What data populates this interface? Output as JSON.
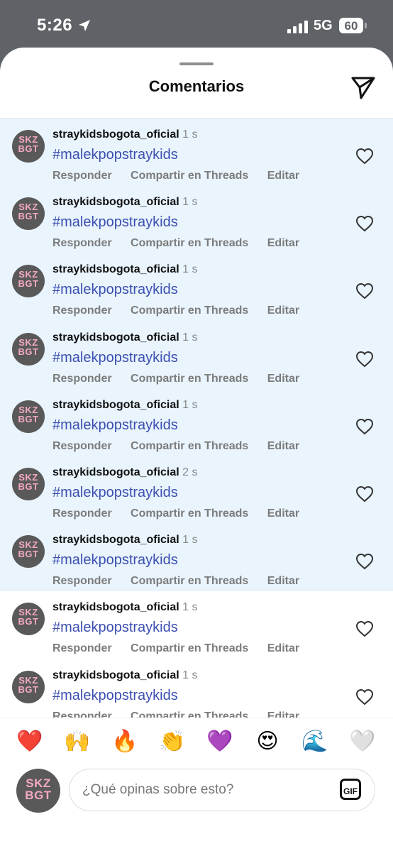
{
  "status_bar": {
    "time": "5:26",
    "network": "5G",
    "battery": "60"
  },
  "header": {
    "title": "Comentarios"
  },
  "avatar_text": [
    "SKZ",
    "BGT"
  ],
  "comments": [
    {
      "user": "straykidsbogota_oficial",
      "time": "1 s",
      "text": "#malekpopstraykids",
      "highlighted": true
    },
    {
      "user": "straykidsbogota_oficial",
      "time": "1 s",
      "text": "#malekpopstraykids",
      "highlighted": true
    },
    {
      "user": "straykidsbogota_oficial",
      "time": "1 s",
      "text": "#malekpopstraykids",
      "highlighted": true
    },
    {
      "user": "straykidsbogota_oficial",
      "time": "1 s",
      "text": "#malekpopstraykids",
      "highlighted": true
    },
    {
      "user": "straykidsbogota_oficial",
      "time": "1 s",
      "text": "#malekpopstraykids",
      "highlighted": true
    },
    {
      "user": "straykidsbogota_oficial",
      "time": "2 s",
      "text": "#malekpopstraykids",
      "highlighted": true
    },
    {
      "user": "straykidsbogota_oficial",
      "time": "1 s",
      "text": "#malekpopstraykids",
      "highlighted": true
    },
    {
      "user": "straykidsbogota_oficial",
      "time": "1 s",
      "text": "#malekpopstraykids",
      "highlighted": false
    },
    {
      "user": "straykidsbogota_oficial",
      "time": "1 s",
      "text": "#malekpopstraykids",
      "highlighted": false
    }
  ],
  "actions": {
    "reply": "Responder",
    "share": "Compartir en Threads",
    "edit": "Editar"
  },
  "emojis": [
    "❤️",
    "🙌",
    "🔥",
    "👏",
    "💜",
    "😍",
    "🌊",
    "🤍"
  ],
  "composer": {
    "placeholder": "¿Qué opinas sobre esto?",
    "gif_label": "GIF"
  },
  "colors": {
    "highlight": "#e9f4fd",
    "hashtag": "#3b4fb0",
    "status_bg": "#5f6367"
  }
}
